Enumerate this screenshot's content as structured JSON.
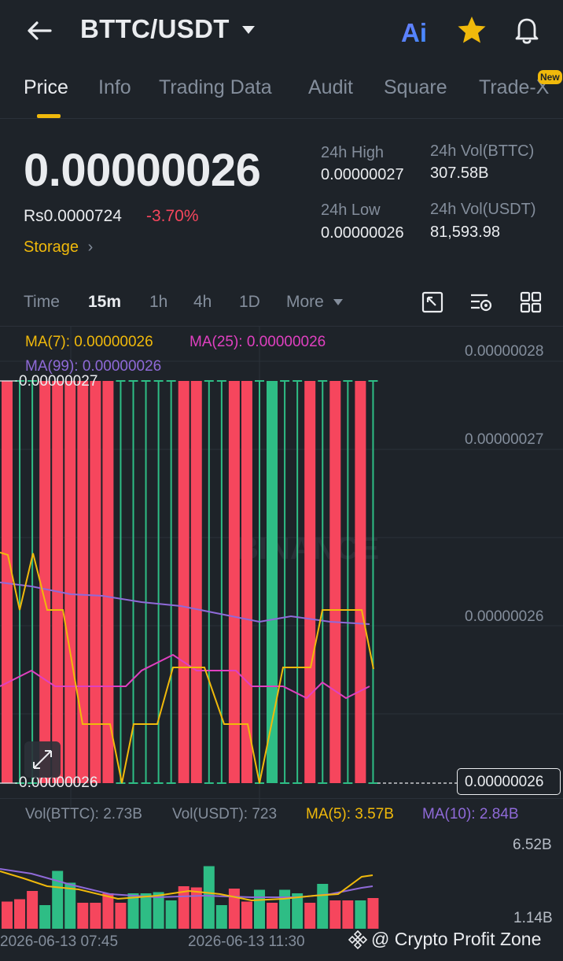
{
  "header": {
    "title": "BTTC/USDT",
    "ai_label": "Ai",
    "star_color": "#f0b90b",
    "icons": [
      "back-arrow-icon",
      "caret-down-icon",
      "ai-icon",
      "star-icon",
      "bell-icon"
    ]
  },
  "tabs": [
    {
      "label": "Price",
      "active": true
    },
    {
      "label": "Info"
    },
    {
      "label": "Trading Data"
    },
    {
      "label": "Audit"
    },
    {
      "label": "Square"
    },
    {
      "label": "Trade-X",
      "badge": "New"
    }
  ],
  "ticker": {
    "price": "0.00000026",
    "local_price": "Rs0.0000724",
    "change": "-3.70%",
    "storage_label": "Storage",
    "high_label": "24h High",
    "high_value": "0.00000027",
    "low_label": "24h Low",
    "low_value": "0.00000026",
    "vol_base_label": "24h Vol(BTTC)",
    "vol_base_value": "307.58B",
    "vol_quote_label": "24h Vol(USDT)",
    "vol_quote_value": "81,593.98"
  },
  "intervals": [
    {
      "label": "Time"
    },
    {
      "label": "15m",
      "active": true
    },
    {
      "label": "1h"
    },
    {
      "label": "4h"
    },
    {
      "label": "1D"
    },
    {
      "label": "More"
    }
  ],
  "chart_tools": [
    "expand-chart-icon",
    "indicator-settings-icon",
    "grid-layout-icon"
  ],
  "indicators": {
    "ma7": "MA(7): 0.00000026",
    "ma25": "MA(25): 0.00000026",
    "ma99": "MA(99): 0.00000026"
  },
  "volume_labels": {
    "vol_base": "Vol(BTTC): 2.73B",
    "vol_quote": "Vol(USDT): 723",
    "ma5": "MA(5): 3.57B",
    "ma10": "MA(10): 2.84B"
  },
  "watermark": "BINANCE",
  "footer": {
    "credit": "@ Crypto Profit Zone"
  },
  "colors": {
    "background": "#1e2329",
    "up": "#2ebd85",
    "down": "#f6465d",
    "accent": "#f0b90b",
    "ma7": "#f0b90b",
    "ma25": "#e040c0",
    "ma99": "#8f6ad8"
  },
  "chart_data": [
    {
      "type": "candlestick",
      "y_ticks": [
        "0.00000028",
        "0.00000027",
        "0.00000026"
      ],
      "high_marker": "0.00000027",
      "low_marker": "0.00000026",
      "last_price": "0.00000026",
      "candles": [
        "down",
        "up",
        "up",
        "down",
        "down",
        "down",
        "down",
        "down",
        "down",
        "up",
        "up",
        "up",
        "up",
        "up",
        "down",
        "down",
        "up",
        "up",
        "down",
        "down",
        "up",
        "down",
        "up",
        "up",
        "down",
        "up",
        "down",
        "up",
        "down",
        "up"
      ],
      "ma_series": [
        {
          "name": "MA(7)",
          "values": [
            2.6e-07,
            2.6e-07,
            2.6e-07,
            2.6e-07,
            2.6e-07
          ]
        },
        {
          "name": "MA(25)",
          "values": [
            2.6e-07,
            2.6e-07,
            2.6e-07,
            2.6e-07,
            2.6e-07
          ]
        },
        {
          "name": "MA(99)",
          "values": [
            2.6e-07,
            2.6e-07,
            2.6e-07,
            2.6e-07,
            2.6e-07
          ]
        }
      ]
    },
    {
      "type": "bar",
      "y_ticks": [
        "6.52B",
        "1.14B"
      ],
      "x_ticks": [
        "2026-06-13 07:45",
        "2026-06-13 11:30"
      ],
      "volume_colors": [
        "down",
        "down",
        "down",
        "up",
        "up",
        "up",
        "down",
        "down",
        "down",
        "down",
        "up",
        "up",
        "up",
        "up",
        "down",
        "down",
        "up",
        "up",
        "down",
        "down",
        "up",
        "down",
        "up",
        "up",
        "down",
        "up",
        "down",
        "down",
        "up",
        "down"
      ],
      "volume_values_b": [
        2.3,
        2.5,
        3.2,
        2.0,
        4.9,
        3.9,
        2.2,
        2.2,
        3.0,
        2.2,
        3.0,
        3.0,
        3.1,
        2.4,
        3.6,
        3.5,
        5.3,
        2.0,
        3.4,
        2.3,
        3.3,
        2.2,
        3.3,
        3.0,
        2.2,
        3.8,
        2.4,
        2.4,
        2.4,
        2.6
      ]
    }
  ]
}
